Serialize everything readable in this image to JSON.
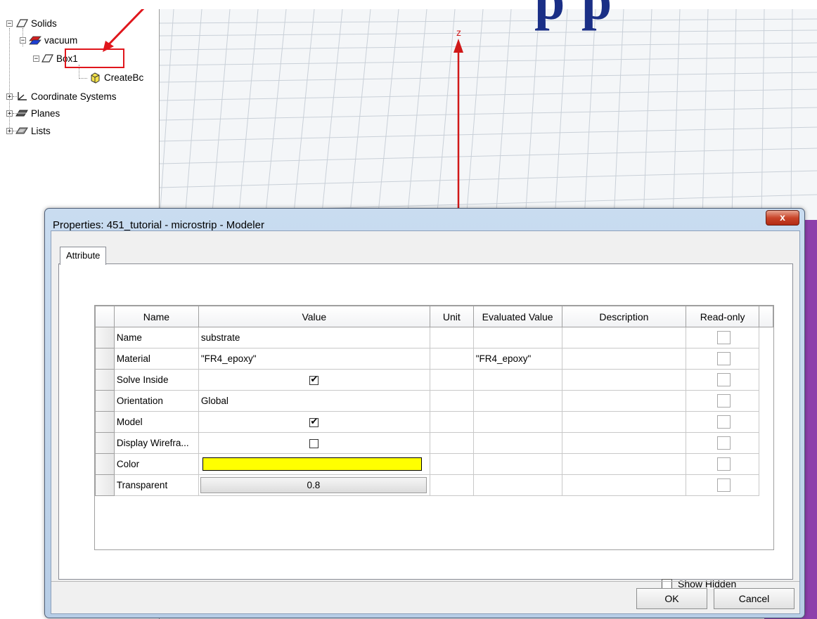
{
  "tree": {
    "items": [
      {
        "label": "Solids",
        "expander": "−",
        "icon": "solid-icon"
      },
      {
        "label": "vacuum",
        "expander": "−",
        "icon": "vacuum-icon"
      },
      {
        "label": "Box1",
        "expander": "−",
        "icon": "box-icon"
      },
      {
        "label": "CreateBc",
        "icon": "create-box-icon"
      },
      {
        "label": "Coordinate Systems",
        "expander": "+",
        "icon": "axes-icon"
      },
      {
        "label": "Planes",
        "expander": "+",
        "icon": "plane-icon"
      },
      {
        "label": "Lists",
        "expander": "+",
        "icon": "list-icon"
      }
    ]
  },
  "viewport": {
    "axis_label": "z",
    "heading_fragment": "p p"
  },
  "dialog": {
    "title": "Properties: 451_tutorial - microstrip - Modeler",
    "close_label": "x",
    "tab_label": "Attribute",
    "columns": [
      "Name",
      "Value",
      "Unit",
      "Evaluated Value",
      "Description",
      "Read-only"
    ],
    "rows": [
      {
        "name": "Name",
        "value": "substrate",
        "unit": "",
        "evaluated": "",
        "description": ""
      },
      {
        "name": "Material",
        "value": "\"FR4_epoxy\"",
        "unit": "",
        "evaluated": "\"FR4_epoxy\"",
        "description": ""
      },
      {
        "name": "Solve Inside",
        "value": "",
        "checked": true,
        "unit": "",
        "evaluated": "",
        "description": ""
      },
      {
        "name": "Orientation",
        "value": "Global",
        "unit": "",
        "evaluated": "",
        "description": ""
      },
      {
        "name": "Model",
        "value": "",
        "checked": true,
        "unit": "",
        "evaluated": "",
        "description": ""
      },
      {
        "name": "Display Wirefra...",
        "value": "",
        "checked": false,
        "unit": "",
        "evaluated": "",
        "description": ""
      },
      {
        "name": "Color",
        "value": "",
        "color": "#ffff00",
        "unit": "",
        "evaluated": "",
        "description": ""
      },
      {
        "name": "Transparent",
        "value": "0.8",
        "unit": "",
        "evaluated": "",
        "description": ""
      }
    ],
    "show_hidden_label": "Show Hidden",
    "ok_label": "OK",
    "cancel_label": "Cancel"
  },
  "colors": {
    "highlight": "#e0161c",
    "axis": "#d01818",
    "object": "#7a1f9e"
  }
}
